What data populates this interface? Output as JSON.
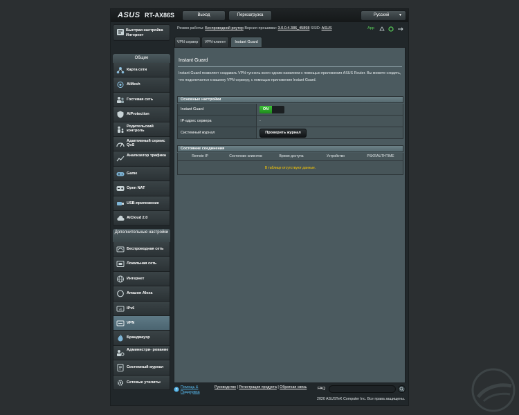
{
  "header": {
    "logo": "ASUS",
    "model": "RT-AX86S",
    "logout_label": "Выход",
    "reboot_label": "Перезагрузка",
    "language": "Русский"
  },
  "sidebar": {
    "quick_setup": "Быстрая настройка Интернет",
    "general_title": "Общие",
    "general_items": [
      {
        "label": "Карта сети",
        "icon": "network-map-icon"
      },
      {
        "label": "AiMesh",
        "icon": "aimesh-icon"
      },
      {
        "label": "Гостевая сеть",
        "icon": "guest-network-icon"
      },
      {
        "label": "AiProtection",
        "icon": "aiprotection-icon"
      },
      {
        "label": "Родительский контроль",
        "icon": "parental-control-icon"
      },
      {
        "label": "Адаптивный сервис QoS",
        "icon": "qos-icon"
      },
      {
        "label": "Анализатор трафика",
        "icon": "traffic-analyzer-icon"
      },
      {
        "label": "Game",
        "icon": "game-icon"
      },
      {
        "label": "Open NAT",
        "icon": "open-nat-icon"
      },
      {
        "label": "USB-приложение",
        "icon": "usb-icon"
      },
      {
        "label": "AiCloud 2.0",
        "icon": "aicloud-icon"
      }
    ],
    "advanced_title": "Дополнительные настройки",
    "advanced_items": [
      {
        "label": "Беспроводная сеть",
        "icon": "wireless-icon"
      },
      {
        "label": "Локальная сеть",
        "icon": "lan-icon"
      },
      {
        "label": "Интернет",
        "icon": "wan-icon"
      },
      {
        "label": "Amazon Alexa",
        "icon": "alexa-icon"
      },
      {
        "label": "IPv6",
        "icon": "ipv6-icon"
      },
      {
        "label": "VPN",
        "icon": "vpn-icon"
      },
      {
        "label": "Брандмауэр",
        "icon": "firewall-icon"
      },
      {
        "label": "Администри- рование",
        "icon": "administration-icon"
      },
      {
        "label": "Системный журнал",
        "icon": "system-log-icon"
      },
      {
        "label": "Сетевые утилиты",
        "icon": "network-tools-icon"
      }
    ]
  },
  "status": {
    "mode_label": "Режим работы:",
    "mode_value": "Беспроводной роутер",
    "fw_label": "Версия прошивки:",
    "fw_value": "3.0.0.4.386_45898",
    "ssid_label": "SSID:",
    "ssid_value": "ASUS",
    "app_label": "App"
  },
  "tabs": [
    {
      "label": "VPN сервер"
    },
    {
      "label": "VPN-клиент"
    },
    {
      "label": "Instant Guard"
    }
  ],
  "main": {
    "title": "Instant Guard",
    "description": "Instant Guard позволяет создавать VPN-туннель всего одним нажатием с помощью приложения ASUS Router. Вы можете сходить, что подключается к вашему VPN-серверу, с помощью приложения Instant Guard.",
    "basic_title": "Основные настройки",
    "rows": {
      "instant_guard_label": "Instant Guard",
      "toggle_label": "ON",
      "server_ip_label": "IP-адрес сервера",
      "server_ip_value": "-",
      "syslog_label": "Системный журнал",
      "check_log_button": "Проверить журнал"
    },
    "connection_title": "Состояние соединения",
    "columns": [
      "Remote IP",
      "Состояние клиентов",
      "Время доступа",
      "Устройство",
      "PSKRAUTHTIME"
    ],
    "empty_message": "В таблице отсутствуют данные."
  },
  "footer": {
    "help": "Помощь & Поддержка",
    "manual": "Руководство",
    "register": "Регистрация продукта",
    "feedback": "Обратная связь",
    "separator": "|",
    "faq": "FAQ",
    "copyright": "2020 ASUSTeK Computer Inc. Все права защищены."
  },
  "colors": {
    "accent_blue": "#57b7ea",
    "on_green": "#2db529",
    "warning_yellow": "#ffcc00",
    "panel": "#4b5a5f"
  }
}
